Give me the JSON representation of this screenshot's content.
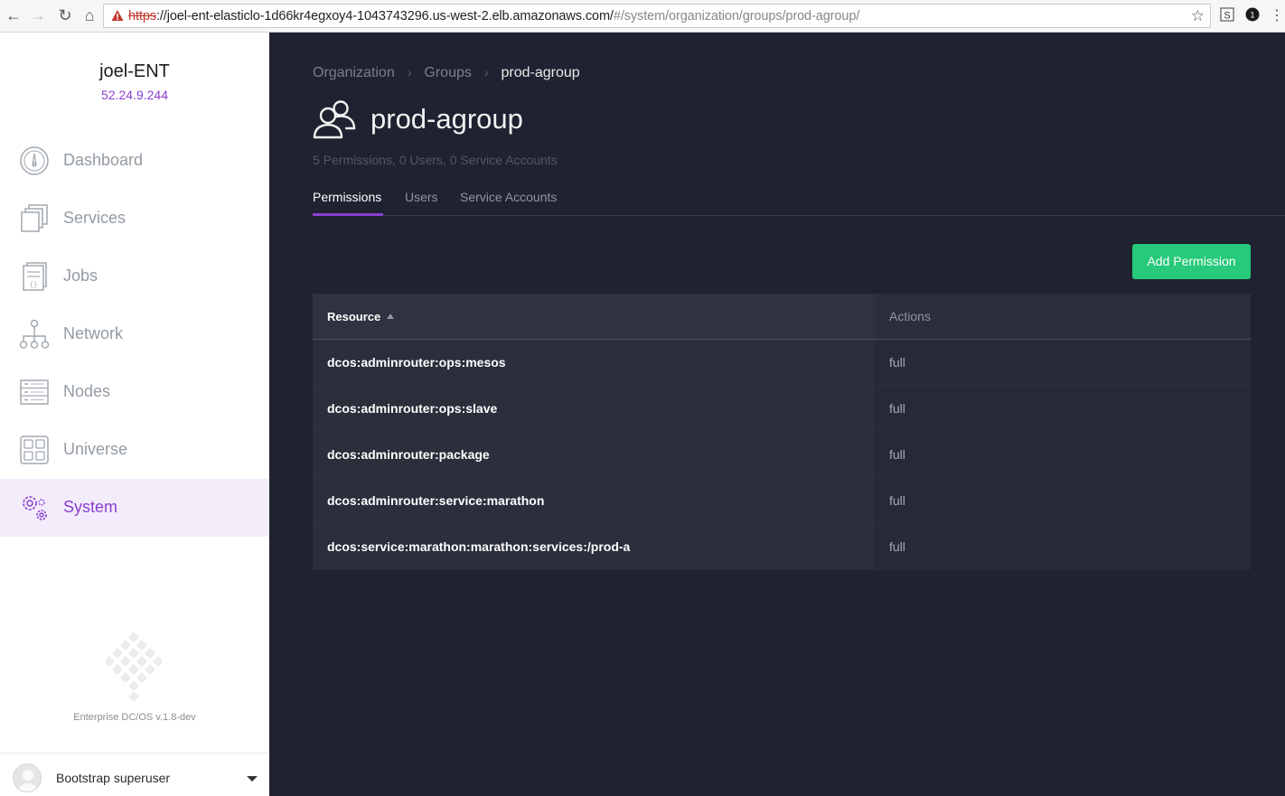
{
  "browser": {
    "url_scheme": "https",
    "url_host": "://joel-ent-elasticlo-1d66kr4egxoy4-1043743296.us-west-2.elb.amazonaws.com/",
    "url_hash": "#/system/organization/groups/prod-agroup/"
  },
  "sidebar": {
    "cluster_name": "joel-ENT",
    "cluster_ip": "52.24.9.244",
    "items": [
      {
        "label": "Dashboard",
        "icon": "dashboard-icon"
      },
      {
        "label": "Services",
        "icon": "services-icon"
      },
      {
        "label": "Jobs",
        "icon": "jobs-icon"
      },
      {
        "label": "Network",
        "icon": "network-icon"
      },
      {
        "label": "Nodes",
        "icon": "nodes-icon"
      },
      {
        "label": "Universe",
        "icon": "universe-icon"
      },
      {
        "label": "System",
        "icon": "system-gear-icon",
        "active": true
      }
    ],
    "version": "Enterprise DC/OS v.1.8-dev",
    "user_name": "Bootstrap superuser"
  },
  "breadcrumb": [
    "Organization",
    "Groups",
    "prod-agroup"
  ],
  "page": {
    "title": "prod-agroup",
    "subtitle": "5 Permissions, 0 Users, 0 Service Accounts"
  },
  "tabs": [
    "Permissions",
    "Users",
    "Service Accounts"
  ],
  "add_button_label": "Add Permission",
  "table": {
    "columns": [
      "Resource",
      "Actions"
    ],
    "rows": [
      {
        "resource": "dcos:adminrouter:ops:mesos",
        "action": "full"
      },
      {
        "resource": "dcos:adminrouter:ops:slave",
        "action": "full"
      },
      {
        "resource": "dcos:adminrouter:package",
        "action": "full"
      },
      {
        "resource": "dcos:adminrouter:service:marathon",
        "action": "full"
      },
      {
        "resource": "dcos:service:marathon:marathon:services:/prod-a",
        "action": "full"
      }
    ]
  },
  "colors": {
    "accent": "#8b3fd1",
    "success": "#27c97a",
    "main_bg": "#1f2230"
  }
}
